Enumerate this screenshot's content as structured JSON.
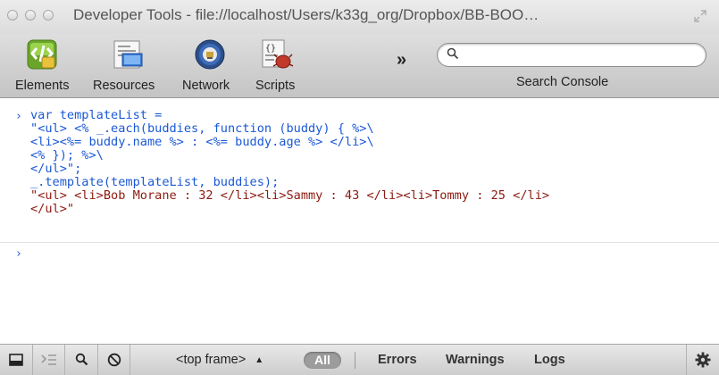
{
  "window": {
    "title": "Developer Tools - file://localhost/Users/k33g_org/Dropbox/BB-BOO…"
  },
  "toolbar": {
    "tools": [
      {
        "label": "Elements",
        "icon": "elements-icon"
      },
      {
        "label": "Resources",
        "icon": "resources-icon"
      },
      {
        "label": "Network",
        "icon": "network-icon"
      },
      {
        "label": "Scripts",
        "icon": "scripts-icon"
      }
    ],
    "overflow": "»",
    "search": {
      "placeholder": "",
      "value": "",
      "label": "Search Console"
    }
  },
  "console": {
    "input_lines": [
      "var templateList =",
      "\"<ul> <% _.each(buddies, function (buddy) { %>\\",
      "<li><%= buddy.name %> : <%= buddy.age %> </li>\\",
      "<% }); %>\\",
      "</ul>\";",
      "_.template(templateList, buddies);"
    ],
    "output_lines": [
      "\"<ul> <li>Bob Morane : 32 </li><li>Sammy : 43 </li><li>Tommy : 25 </li>",
      "</ul>\""
    ],
    "prompt": "›"
  },
  "statusbar": {
    "frame": "<top frame>",
    "filters": {
      "all": "All",
      "errors": "Errors",
      "warnings": "Warnings",
      "logs": "Logs"
    }
  },
  "colors": {
    "command_text": "#1a58d6",
    "result_text": "#8c1a10"
  }
}
